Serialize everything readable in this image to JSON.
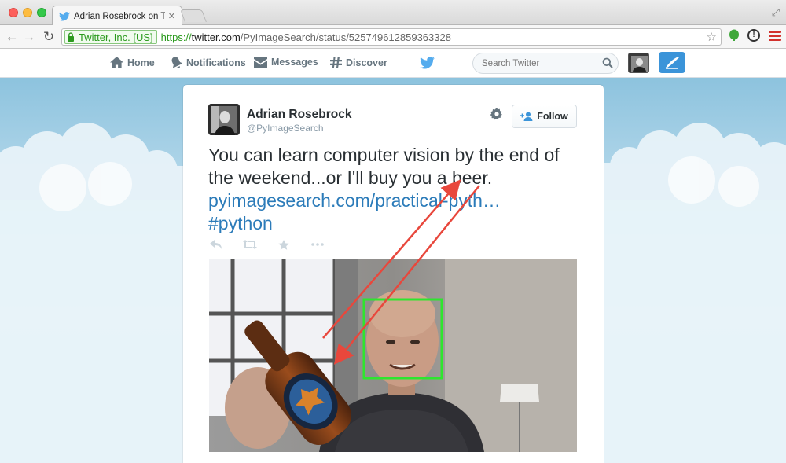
{
  "browser": {
    "tab_title": "Adrian Rosebrock on Twitter",
    "ev_name": "Twitter, Inc. [US]",
    "url_scheme": "https://",
    "url_host": "twitter.com",
    "url_path": "/PyImageSearch/status/525749612859363328"
  },
  "nav": {
    "home": "Home",
    "notifications": "Notifications",
    "messages": "Messages",
    "discover": "Discover",
    "search_placeholder": "Search Twitter"
  },
  "tweet": {
    "fullname": "Adrian Rosebrock",
    "username": "@PyImageSearch",
    "follow_label": "Follow",
    "text": "You can learn computer vision by the end of the weekend...or I'll buy you a beer.",
    "link": "pyimagesearch.com/practical-pyth…",
    "hashtag": "#python"
  },
  "colors": {
    "twitter_blue": "#55acee",
    "link": "#2b7bb9",
    "detection_box": "#2ee62e",
    "annotation_arrow": "#e8473c"
  },
  "icons": [
    "home-icon",
    "bell-icon",
    "envelope-icon",
    "hash-icon",
    "twitter-bird-icon",
    "search-icon",
    "compose-icon",
    "gear-icon",
    "follow-person-icon",
    "reply-icon",
    "retweet-icon",
    "favorite-icon",
    "more-icon"
  ]
}
